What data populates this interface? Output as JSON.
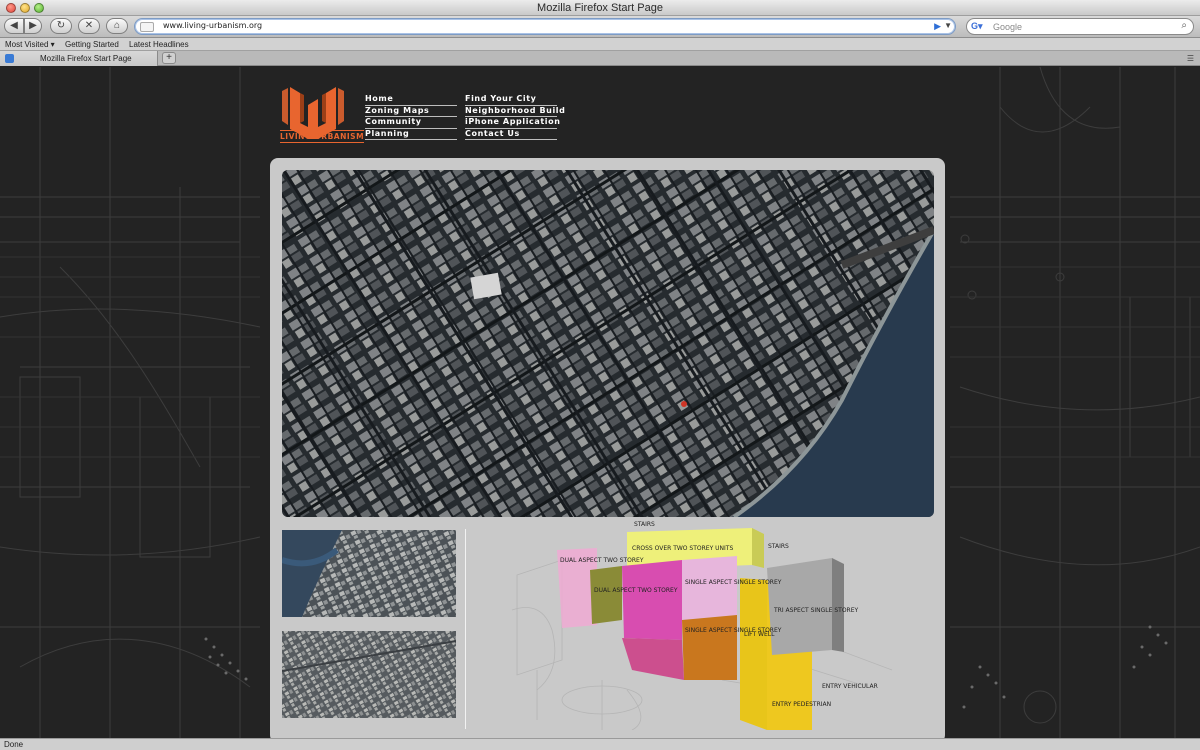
{
  "window": {
    "title": "Mozilla Firefox Start Page"
  },
  "toolbar": {
    "url": "www.living-urbanism.org",
    "search_placeholder": "Google"
  },
  "bookmarks": [
    "Most Visited ▾",
    "Getting Started",
    "Latest Headlines"
  ],
  "tabs": [
    {
      "label": "Mozilla Firefox Start Page"
    }
  ],
  "site": {
    "logo_text": "LIVING URBANISM",
    "brand_color": "#e8652f",
    "nav_col1": [
      "Home",
      "Zoning Maps",
      "Community",
      "Planning"
    ],
    "nav_col2": [
      "Find Your City",
      "Neighborhood Build",
      "iPhone Application",
      "Contact Us"
    ]
  },
  "diagram_labels": {
    "stairs_top": "STAIRS",
    "cross_over": "CROSS OVER TWO STOREY UNITS",
    "stairs_right": "STAIRS",
    "dual_aspect_two_storey": "DUAL ASPECT TWO STOREY",
    "dual_aspect_1": "DUAL ASPECT TWO STOREY",
    "single_aspect_1": "SINGLE ASPECT SINGLE STOREY",
    "single_aspect_2": "SINGLE ASPECT SINGLE STOREY",
    "lift_well": "LIFT WELL",
    "tri_aspect": "TRI ASPECT SINGLE STOREY",
    "entry_vehicular": "ENTRY VEHICULAR",
    "entry_pedestrian": "ENTRY PEDESTRIAN"
  },
  "status": {
    "text": "Done"
  }
}
